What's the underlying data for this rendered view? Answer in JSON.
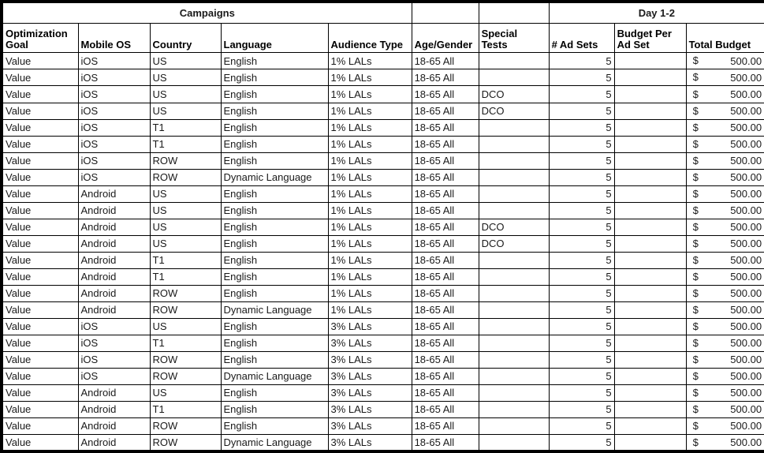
{
  "table": {
    "group_headers": [
      {
        "label": "Campaigns",
        "span": 5
      },
      {
        "label": "",
        "span": 1
      },
      {
        "label": "",
        "span": 1
      },
      {
        "label": "Day 1-2",
        "span": 3
      }
    ],
    "columns": [
      "Optimization Goal",
      "Mobile OS",
      "Country",
      "Language",
      "Audience Type",
      "Age/Gender",
      "Special Tests",
      "# Ad Sets",
      "Budget Per Ad Set",
      "Total Budget"
    ],
    "currency_symbol": "$",
    "rows": [
      {
        "goal": "Value",
        "os": "iOS",
        "country": "US",
        "language": "English",
        "audience": "1% LALs",
        "age_gender": "18-65 All",
        "special_tests": "",
        "ad_sets": "5",
        "budget_per_ad_set": "",
        "total_budget": "500.00"
      },
      {
        "goal": "Value",
        "os": "iOS",
        "country": "US",
        "language": "English",
        "audience": "1% LALs",
        "age_gender": "18-65 All",
        "special_tests": "",
        "ad_sets": "5",
        "budget_per_ad_set": "",
        "total_budget": "500.00"
      },
      {
        "goal": "Value",
        "os": "iOS",
        "country": "US",
        "language": "English",
        "audience": "1% LALs",
        "age_gender": "18-65 All",
        "special_tests": "DCO",
        "ad_sets": "5",
        "budget_per_ad_set": "",
        "total_budget": "500.00"
      },
      {
        "goal": "Value",
        "os": "iOS",
        "country": "US",
        "language": "English",
        "audience": "1% LALs",
        "age_gender": "18-65 All",
        "special_tests": "DCO",
        "ad_sets": "5",
        "budget_per_ad_set": "",
        "total_budget": "500.00"
      },
      {
        "goal": "Value",
        "os": "iOS",
        "country": "T1",
        "language": "English",
        "audience": "1% LALs",
        "age_gender": "18-65 All",
        "special_tests": "",
        "ad_sets": "5",
        "budget_per_ad_set": "",
        "total_budget": "500.00"
      },
      {
        "goal": "Value",
        "os": "iOS",
        "country": "T1",
        "language": "English",
        "audience": "1% LALs",
        "age_gender": "18-65 All",
        "special_tests": "",
        "ad_sets": "5",
        "budget_per_ad_set": "",
        "total_budget": "500.00"
      },
      {
        "goal": "Value",
        "os": "iOS",
        "country": "ROW",
        "language": "English",
        "audience": "1% LALs",
        "age_gender": "18-65 All",
        "special_tests": "",
        "ad_sets": "5",
        "budget_per_ad_set": "",
        "total_budget": "500.00"
      },
      {
        "goal": "Value",
        "os": "iOS",
        "country": "ROW",
        "language": "Dynamic Language",
        "audience": "1% LALs",
        "age_gender": "18-65 All",
        "special_tests": "",
        "ad_sets": "5",
        "budget_per_ad_set": "",
        "total_budget": "500.00"
      },
      {
        "goal": "Value",
        "os": "Android",
        "country": "US",
        "language": "English",
        "audience": "1% LALs",
        "age_gender": "18-65 All",
        "special_tests": "",
        "ad_sets": "5",
        "budget_per_ad_set": "",
        "total_budget": "500.00"
      },
      {
        "goal": "Value",
        "os": "Android",
        "country": "US",
        "language": "English",
        "audience": "1% LALs",
        "age_gender": "18-65 All",
        "special_tests": "",
        "ad_sets": "5",
        "budget_per_ad_set": "",
        "total_budget": "500.00"
      },
      {
        "goal": "Value",
        "os": "Android",
        "country": "US",
        "language": "English",
        "audience": "1% LALs",
        "age_gender": "18-65 All",
        "special_tests": "DCO",
        "ad_sets": "5",
        "budget_per_ad_set": "",
        "total_budget": "500.00"
      },
      {
        "goal": "Value",
        "os": "Android",
        "country": "US",
        "language": "English",
        "audience": "1% LALs",
        "age_gender": "18-65 All",
        "special_tests": "DCO",
        "ad_sets": "5",
        "budget_per_ad_set": "",
        "total_budget": "500.00"
      },
      {
        "goal": "Value",
        "os": "Android",
        "country": "T1",
        "language": "English",
        "audience": "1% LALs",
        "age_gender": "18-65 All",
        "special_tests": "",
        "ad_sets": "5",
        "budget_per_ad_set": "",
        "total_budget": "500.00"
      },
      {
        "goal": "Value",
        "os": "Android",
        "country": "T1",
        "language": "English",
        "audience": "1% LALs",
        "age_gender": "18-65 All",
        "special_tests": "",
        "ad_sets": "5",
        "budget_per_ad_set": "",
        "total_budget": "500.00"
      },
      {
        "goal": "Value",
        "os": "Android",
        "country": "ROW",
        "language": "English",
        "audience": "1% LALs",
        "age_gender": "18-65 All",
        "special_tests": "",
        "ad_sets": "5",
        "budget_per_ad_set": "",
        "total_budget": "500.00"
      },
      {
        "goal": "Value",
        "os": "Android",
        "country": "ROW",
        "language": "Dynamic Language",
        "audience": "1% LALs",
        "age_gender": "18-65 All",
        "special_tests": "",
        "ad_sets": "5",
        "budget_per_ad_set": "",
        "total_budget": "500.00"
      },
      {
        "goal": "Value",
        "os": "iOS",
        "country": "US",
        "language": "English",
        "audience": "3% LALs",
        "age_gender": "18-65 All",
        "special_tests": "",
        "ad_sets": "5",
        "budget_per_ad_set": "",
        "total_budget": "500.00"
      },
      {
        "goal": "Value",
        "os": "iOS",
        "country": "T1",
        "language": "English",
        "audience": "3% LALs",
        "age_gender": "18-65 All",
        "special_tests": "",
        "ad_sets": "5",
        "budget_per_ad_set": "",
        "total_budget": "500.00"
      },
      {
        "goal": "Value",
        "os": "iOS",
        "country": "ROW",
        "language": "English",
        "audience": "3% LALs",
        "age_gender": "18-65 All",
        "special_tests": "",
        "ad_sets": "5",
        "budget_per_ad_set": "",
        "total_budget": "500.00"
      },
      {
        "goal": "Value",
        "os": "iOS",
        "country": "ROW",
        "language": "Dynamic Language",
        "audience": "3% LALs",
        "age_gender": "18-65 All",
        "special_tests": "",
        "ad_sets": "5",
        "budget_per_ad_set": "",
        "total_budget": "500.00"
      },
      {
        "goal": "Value",
        "os": "Android",
        "country": "US",
        "language": "English",
        "audience": "3% LALs",
        "age_gender": "18-65 All",
        "special_tests": "",
        "ad_sets": "5",
        "budget_per_ad_set": "",
        "total_budget": "500.00"
      },
      {
        "goal": "Value",
        "os": "Android",
        "country": "T1",
        "language": "English",
        "audience": "3% LALs",
        "age_gender": "18-65 All",
        "special_tests": "",
        "ad_sets": "5",
        "budget_per_ad_set": "",
        "total_budget": "500.00"
      },
      {
        "goal": "Value",
        "os": "Android",
        "country": "ROW",
        "language": "English",
        "audience": "3% LALs",
        "age_gender": "18-65 All",
        "special_tests": "",
        "ad_sets": "5",
        "budget_per_ad_set": "",
        "total_budget": "500.00"
      },
      {
        "goal": "Value",
        "os": "Android",
        "country": "ROW",
        "language": "Dynamic Language",
        "audience": "3% LALs",
        "age_gender": "18-65 All",
        "special_tests": "",
        "ad_sets": "5",
        "budget_per_ad_set": "",
        "total_budget": "500.00"
      }
    ]
  }
}
